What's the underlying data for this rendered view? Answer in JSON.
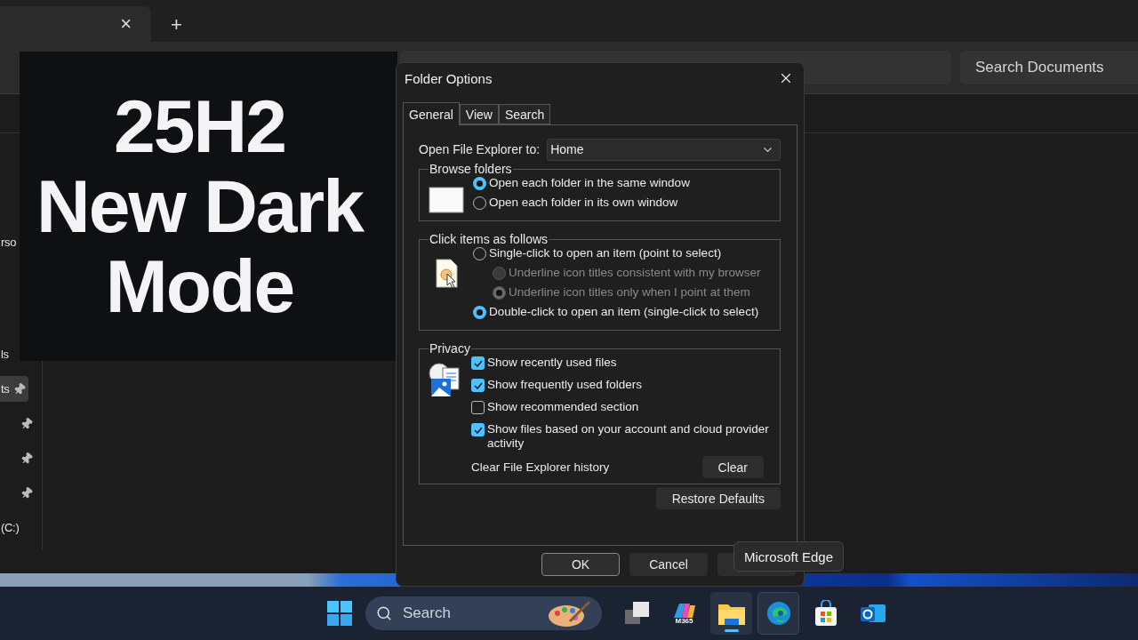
{
  "explorer": {
    "tab_close": "×",
    "new_tab": "+",
    "search": {
      "placeholder": "Search Documents"
    },
    "sidebar": [
      [
        {
          "label": "rso",
          "pinned": false,
          "selected": false
        }
      ],
      [
        {
          "label": "ls",
          "pinned": false,
          "selected": false
        },
        {
          "label": "ts",
          "pinned": true,
          "selected": true
        },
        {
          "pinned": true,
          "selected": false
        },
        {
          "pinned": true,
          "selected": false
        },
        {
          "pinned": true,
          "selected": false
        },
        {
          "label": "(C:)",
          "pinned": false,
          "selected": false
        }
      ]
    ]
  },
  "overlay": {
    "lines": [
      "25H2",
      "New Dark",
      "Mode"
    ]
  },
  "dialog": {
    "title": "Folder Options",
    "tabs": [
      {
        "label": "General",
        "selected": true
      },
      {
        "label": "View",
        "selected": false
      },
      {
        "label": "Search",
        "selected": false
      }
    ],
    "open_to": {
      "label": "Open File Explorer to:",
      "value": "Home"
    },
    "groups": [
      {
        "kind": "window",
        "title": "Browse folders",
        "options": [
          {
            "kind": "radio",
            "label": "Open each folder in the same window",
            "selected": true,
            "disabled": false
          },
          {
            "kind": "radio",
            "label": "Open each folder in its own window",
            "selected": false,
            "disabled": false
          }
        ]
      },
      {
        "kind": "pointer",
        "title": "Click items as follows",
        "options": [
          {
            "kind": "radio",
            "label": "Single-click to open an item (point to select)",
            "selected": false,
            "disabled": false
          },
          {
            "kind": "subradio",
            "label": "Underline icon titles consistent with my browser",
            "selected": false,
            "disabled": true
          },
          {
            "kind": "subradio",
            "label": "Underline icon titles only when I point at them",
            "selected": true,
            "disabled": true
          },
          {
            "kind": "radio",
            "label": "Double-click to open an item (single-click to select)",
            "selected": true,
            "disabled": false
          }
        ]
      },
      {
        "kind": "privacy",
        "title": "Privacy",
        "options": [
          {
            "kind": "checkbox",
            "label": "Show recently used files",
            "checked": true
          },
          {
            "kind": "checkbox",
            "label": "Show frequently used folders",
            "checked": true
          },
          {
            "kind": "checkbox",
            "label": "Show recommended section",
            "checked": false
          },
          {
            "kind": "checkbox",
            "label": "Show files based on your account and cloud provider activity",
            "checked": true
          }
        ],
        "clear_label": "Clear File Explorer history",
        "clear_button": "Clear"
      }
    ],
    "restore_button": "Restore Defaults",
    "buttons": [
      "OK",
      "Cancel"
    ]
  },
  "tooltip": "Microsoft Edge",
  "taskbar": {
    "search": {
      "placeholder": "Search"
    },
    "apps": [
      {
        "kind": "taskview",
        "selected": false,
        "hovered": false
      },
      {
        "kind": "m365",
        "label": "M365",
        "selected": false,
        "hovered": false
      },
      {
        "kind": "explorer",
        "selected": true,
        "hovered": false
      },
      {
        "kind": "edge",
        "selected": false,
        "hovered": true
      },
      {
        "kind": "store",
        "selected": false,
        "hovered": false
      },
      {
        "kind": "outlook",
        "selected": false,
        "hovered": false
      }
    ]
  }
}
